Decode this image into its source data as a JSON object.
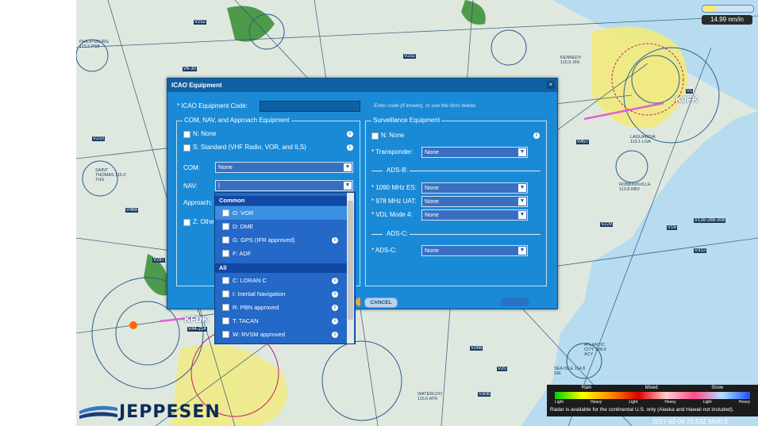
{
  "map": {
    "airport_labels": [
      "KFDK",
      "KJFK"
    ],
    "zoom_label": "14.99 nm/in",
    "vor_labels": [
      "PHILIPSBURG 115.5 PSB",
      "SAINT THOMAS 115.0 THS",
      "KENNEDY 115.9 JFK",
      "LAGUARDIA 113.1 LGA",
      "ROBBINSVILLE 113.8 RBV",
      "SEA ISLE 114.8 SIE",
      "ATLANTIC CITY 108.6 ACY",
      "WATERLOO 116.6 ATR"
    ],
    "airway_labels": [
      "V252",
      "V232",
      "V6-30",
      "V210",
      "V469",
      "V44-214",
      "V457",
      "V312",
      "V139-268-308",
      "V1",
      "V16",
      "V229",
      "V268",
      "V308",
      "V20",
      "V287"
    ],
    "timestamp": "2017-02-08 21:53Z 6600 ft"
  },
  "radar": {
    "categories": [
      "Rain",
      "Mixed",
      "Snow"
    ],
    "ticks": [
      "Light",
      "Heavy",
      "Light",
      "Heavy",
      "Light",
      "Heavy"
    ],
    "note": "Radar is available for the continental U.S. only (Alaska and Hawaii not included).",
    "colors": [
      "#00d200",
      "#ffff00",
      "#ff8c00",
      "#e00000",
      "#ffd0d0",
      "#ff4c8c",
      "#b0e0ff",
      "#2050ff"
    ]
  },
  "logo": {
    "text": "JEPPESEN"
  },
  "dialog": {
    "title": "ICAO Equipment",
    "close_icon": "×",
    "code_label": "* ICAO Equipment Code:",
    "code_hint": "Enter code (if known), or use the form below.",
    "com_group": {
      "title": "COM, NAV, and Approach Equipment",
      "n_label": "N: None",
      "s_label": "S: Standard (VHF Radio, VOR, and ILS)",
      "com_label": "COM:",
      "com_value": "None",
      "nav_label": "NAV:",
      "nav_value": "|",
      "approach_label": "Approach:",
      "z_label": "Z: Othe"
    },
    "surv_group": {
      "title": "Surveillance Equipment",
      "n_label": "N: None",
      "transponder_label": "* Transponder:",
      "transponder_value": "None",
      "adsb_title": "ADS-B:",
      "es_label": "* 1090 MHz ES:",
      "es_value": "None",
      "uat_label": "* 978 MHz UAT:",
      "uat_value": "None",
      "vdl_label": "* VDL Mode 4:",
      "vdl_value": "None",
      "adsc_title": "ADS-C:",
      "adsc_label": "* ADS-C:",
      "adsc_value": "None"
    },
    "cancel_label": "CANCEL"
  },
  "dropdown": {
    "common_header": "Common",
    "common_items": [
      "O: VOR",
      "D: DME",
      "G: GPS (IFR approved)",
      "F: ADF"
    ],
    "all_header": "All",
    "all_items": [
      "C: LORAN C",
      "I: Inertial Navigation",
      "R: PBN approved",
      "T: TACAN",
      "W: RVSM approved"
    ]
  },
  "colors": {
    "dialog_bg": "#1a8ad6",
    "title_bg": "#0f5fa3",
    "dropdown_bg": "#2468c8",
    "highlight": "#3a8fe0"
  }
}
